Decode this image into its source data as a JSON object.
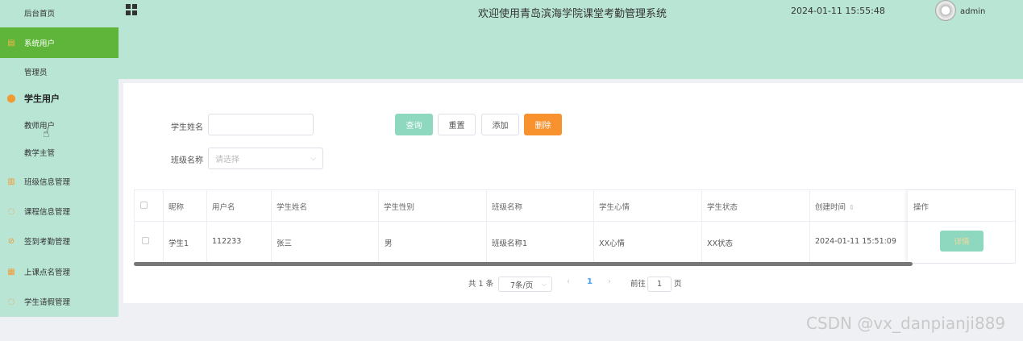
{
  "sidebar": {
    "items": [
      {
        "label": "后台首页",
        "icon": "home-icon"
      },
      {
        "label": "系统用户",
        "icon": "grid-doc-icon"
      },
      {
        "label": "管理员",
        "icon": ""
      },
      {
        "label": "学生用户",
        "icon": "location-pin-icon"
      },
      {
        "label": "教师用户",
        "icon": ""
      },
      {
        "label": "教学主管",
        "icon": ""
      },
      {
        "label": "班级信息管理",
        "icon": "bar-chart-icon"
      },
      {
        "label": "课程信息管理",
        "icon": "chat-bubble-icon"
      },
      {
        "label": "签到考勤管理",
        "icon": "check-circle-icon"
      },
      {
        "label": "上课点名管理",
        "icon": "document-icon"
      },
      {
        "label": "学生请假管理",
        "icon": "chat-bubble-icon"
      }
    ]
  },
  "header": {
    "title": "欢迎使用青岛滨海学院课堂考勤管理系统",
    "datetime": "2024-01-11 15:55:48",
    "user": "admin"
  },
  "search": {
    "name_label": "学生姓名",
    "name_value": "",
    "class_label": "班级名称",
    "class_placeholder": "请选择"
  },
  "buttons": {
    "query": "查询",
    "reset": "重置",
    "add": "添加",
    "delete": "删除"
  },
  "table": {
    "headers": [
      "昵称",
      "用户名",
      "学生姓名",
      "学生性别",
      "班级名称",
      "学生心情",
      "学生状态",
      "创建时间",
      "操作"
    ],
    "rows": [
      [
        "学生1",
        "112233",
        "张三",
        "男",
        "班级名称1",
        "XX心情",
        "XX状态",
        "2024-01-11 15:51:09"
      ]
    ],
    "detail_button": "详情"
  },
  "pagination": {
    "total": "共 1 条",
    "page_size": "7条/页",
    "prev": "‹",
    "current": "1",
    "next": "›",
    "goto_label": "前往",
    "goto_value": "1",
    "page_unit": "页"
  },
  "watermark": "CSDN @vx_danpianji889",
  "colors": {
    "theme_bg": "#b9e5d5",
    "active_menu": "#5fb53a",
    "accent_teal": "#8fd8c0",
    "delete_orange": "#f7922f"
  }
}
